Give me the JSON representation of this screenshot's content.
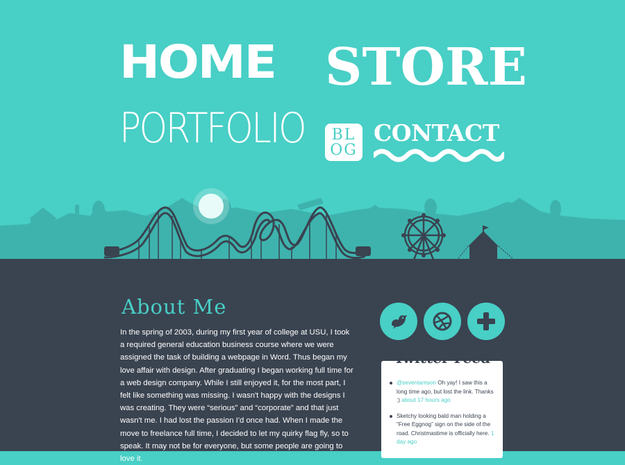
{
  "nav": {
    "home": "HOME",
    "store": "STORE",
    "portfolio": "PORTFOLIO",
    "blog_top": "BL",
    "blog_bottom": "OG",
    "contact": "CONTACT"
  },
  "about": {
    "title": "About Me",
    "text": "In the spring of 2003, during my first year of college at USU, I took a required general education business course where we were assigned the task of building a webpage in Word. Thus began my love affair with design. After graduating I began working full time for a web design company. While I still enjoyed it, for the most part, I felt like something was missing. I wasn't happy with the designs I was creating. They were “serious” and “corporate” and that just wasn't me. I had lost the passion I'd once had. When I made the move to freelance full time, I decided to let my quirky flag fly, so to speak. It may not be for everyone, but some people are going to love it."
  },
  "social": {
    "twitter_icon": "bird-icon",
    "dribbble_icon": "dribbble-ball-icon",
    "plus_icon": "plus-icon"
  },
  "twitter_feed": {
    "title": "Twitter Feed",
    "tweets": [
      {
        "handle": "@seventamson",
        "text": " Oh yay! I saw this a long time ago, but lost the link. Thanks :) ",
        "time": "about 17 hours ago"
      },
      {
        "handle": "",
        "text": "Sketchy looking bald man holding a “Free Eggnog” sign on the side of the road. Christmastime is officially here. ",
        "time": "1 day ago"
      }
    ]
  },
  "colors": {
    "teal": "#48cfc6",
    "dark": "#3a4350",
    "skyline": "#3eb3ad",
    "silhouette": "#3a4350"
  }
}
